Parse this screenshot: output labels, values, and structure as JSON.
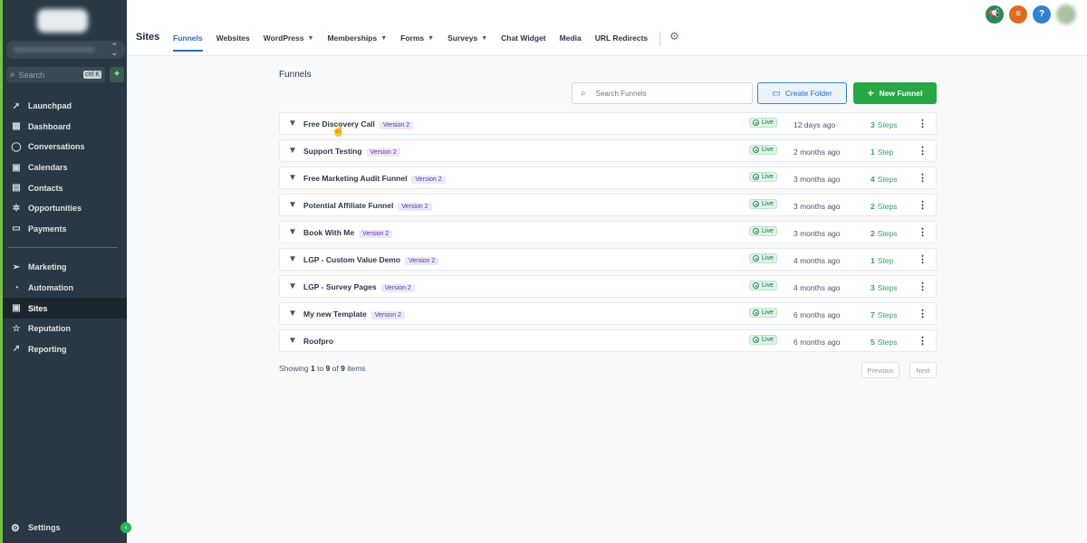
{
  "sidebar": {
    "search_placeholder": "Search",
    "search_shortcut": "ctrl K",
    "quick_add_icon": "plus-icon",
    "items": [
      {
        "label": "Launchpad",
        "icon": "rocket-icon"
      },
      {
        "label": "Dashboard",
        "icon": "grid-icon"
      },
      {
        "label": "Conversations",
        "icon": "chat-icon"
      },
      {
        "label": "Calendars",
        "icon": "calendar-icon"
      },
      {
        "label": "Contacts",
        "icon": "contacts-icon"
      },
      {
        "label": "Opportunities",
        "icon": "opportunities-icon"
      },
      {
        "label": "Payments",
        "icon": "payments-icon"
      }
    ],
    "items2": [
      {
        "label": "Marketing",
        "icon": "send-icon"
      },
      {
        "label": "Automation",
        "icon": "automation-icon"
      },
      {
        "label": "Sites",
        "icon": "sites-icon",
        "active": true
      },
      {
        "label": "Reputation",
        "icon": "star-icon"
      },
      {
        "label": "Reporting",
        "icon": "chart-icon"
      }
    ],
    "settings_label": "Settings"
  },
  "header": {
    "title": "Sites",
    "tabs": [
      {
        "label": "Funnels",
        "active": true
      },
      {
        "label": "Websites"
      },
      {
        "label": "WordPress",
        "dropdown": true
      },
      {
        "label": "Memberships",
        "dropdown": true
      },
      {
        "label": "Forms",
        "dropdown": true
      },
      {
        "label": "Surveys",
        "dropdown": true
      },
      {
        "label": "Chat Widget"
      },
      {
        "label": "Media"
      },
      {
        "label": "URL Redirects"
      }
    ]
  },
  "main": {
    "title": "Funnels",
    "search_placeholder": "Search Funnels",
    "create_folder_label": "Create Folder",
    "new_funnel_label": "New Funnel",
    "rows": [
      {
        "name": "Free Discovery Call",
        "version": "Version 2",
        "status": "Live",
        "updated": "12 days ago",
        "steps_count": "3",
        "steps_label": "Steps"
      },
      {
        "name": "Support Testing",
        "version": "Version 2",
        "status": "Live",
        "updated": "2 months ago",
        "steps_count": "1",
        "steps_label": "Step"
      },
      {
        "name": "Free Marketing Audit Funnel",
        "version": "Version 2",
        "status": "Live",
        "updated": "3 months ago",
        "steps_count": "4",
        "steps_label": "Steps"
      },
      {
        "name": "Potential Affiliate Funnel",
        "version": "Version 2",
        "status": "Live",
        "updated": "3 months ago",
        "steps_count": "2",
        "steps_label": "Steps"
      },
      {
        "name": "Book With Me",
        "version": "Version 2",
        "status": "Live",
        "updated": "3 months ago",
        "steps_count": "2",
        "steps_label": "Steps"
      },
      {
        "name": "LGP - Custom Value Demo",
        "version": "Version 2",
        "status": "Live",
        "updated": "4 months ago",
        "steps_count": "1",
        "steps_label": "Step"
      },
      {
        "name": "LGP - Survey Pages",
        "version": "Version 2",
        "status": "Live",
        "updated": "4 months ago",
        "steps_count": "3",
        "steps_label": "Steps"
      },
      {
        "name": "My new Template",
        "version": "Version 2",
        "status": "Live",
        "updated": "6 months ago",
        "steps_count": "7",
        "steps_label": "Steps"
      },
      {
        "name": "Roofpro",
        "version": "",
        "status": "Live",
        "updated": "6 months ago",
        "steps_count": "5",
        "steps_label": "Steps"
      }
    ],
    "pagination": {
      "showing_prefix": "Showing",
      "from": "1",
      "to_word": "to",
      "to": "9",
      "of_word": "of",
      "total": "9",
      "items_word": "items",
      "prev_label": "Previous",
      "next_label": "Next"
    }
  },
  "colors": {
    "sidebar_bg": "#2a3845",
    "accent_blue": "#2b6cb0",
    "primary_green": "#27a844",
    "frame_green": "#7cc243"
  }
}
